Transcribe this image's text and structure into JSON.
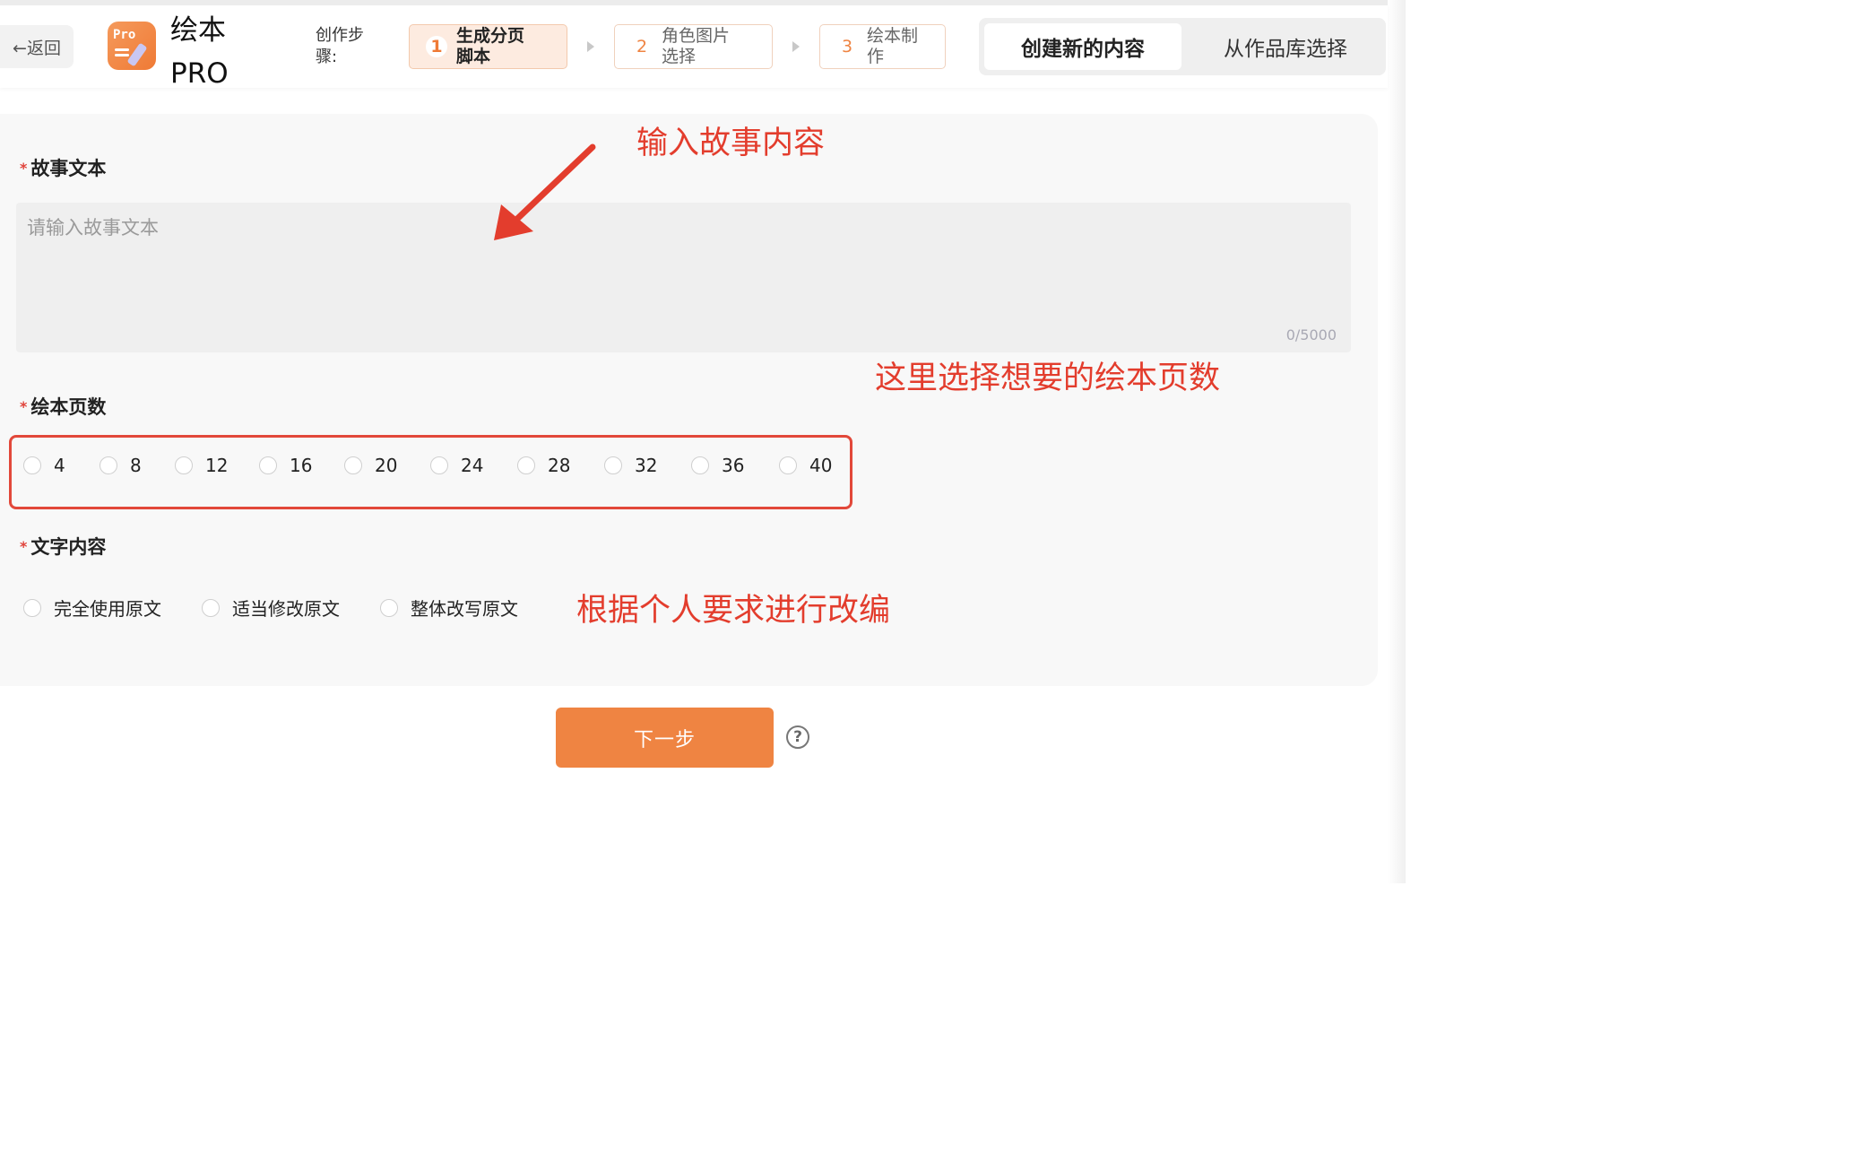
{
  "header": {
    "back_label": "←返回",
    "app_title_line1": "绘本",
    "app_title_line2": "PRO",
    "logo_text": "Pro",
    "steps_label": "创作步骤:",
    "steps": [
      {
        "num": "1",
        "label": "生成分页脚本",
        "active": true
      },
      {
        "num": "2",
        "label": "角色图片选择",
        "active": false
      },
      {
        "num": "3",
        "label": "绘本制作",
        "active": false
      }
    ],
    "mode_toggle": {
      "active": "创建新的内容",
      "other": "从作品库选择"
    }
  },
  "form": {
    "story": {
      "label": "故事文本",
      "placeholder": "请输入故事文本",
      "count": "0/5000"
    },
    "pages": {
      "label": "绘本页数",
      "options": [
        "4",
        "8",
        "12",
        "16",
        "20",
        "24",
        "28",
        "32",
        "36",
        "40"
      ]
    },
    "text_content": {
      "label": "文字内容",
      "options": [
        "完全使用原文",
        "适当修改原文",
        "整体改写原文"
      ]
    },
    "required_mark": "*"
  },
  "actions": {
    "next_label": "下一步",
    "help_glyph": "?"
  },
  "annotations": {
    "story_hint": "输入故事内容",
    "pages_hint": "这里选择想要的绘本页数",
    "text_hint": "根据个人要求进行改编"
  },
  "colors": {
    "accent": "#ef8442",
    "annotation": "#e33d2d",
    "required": "#e0433b"
  }
}
